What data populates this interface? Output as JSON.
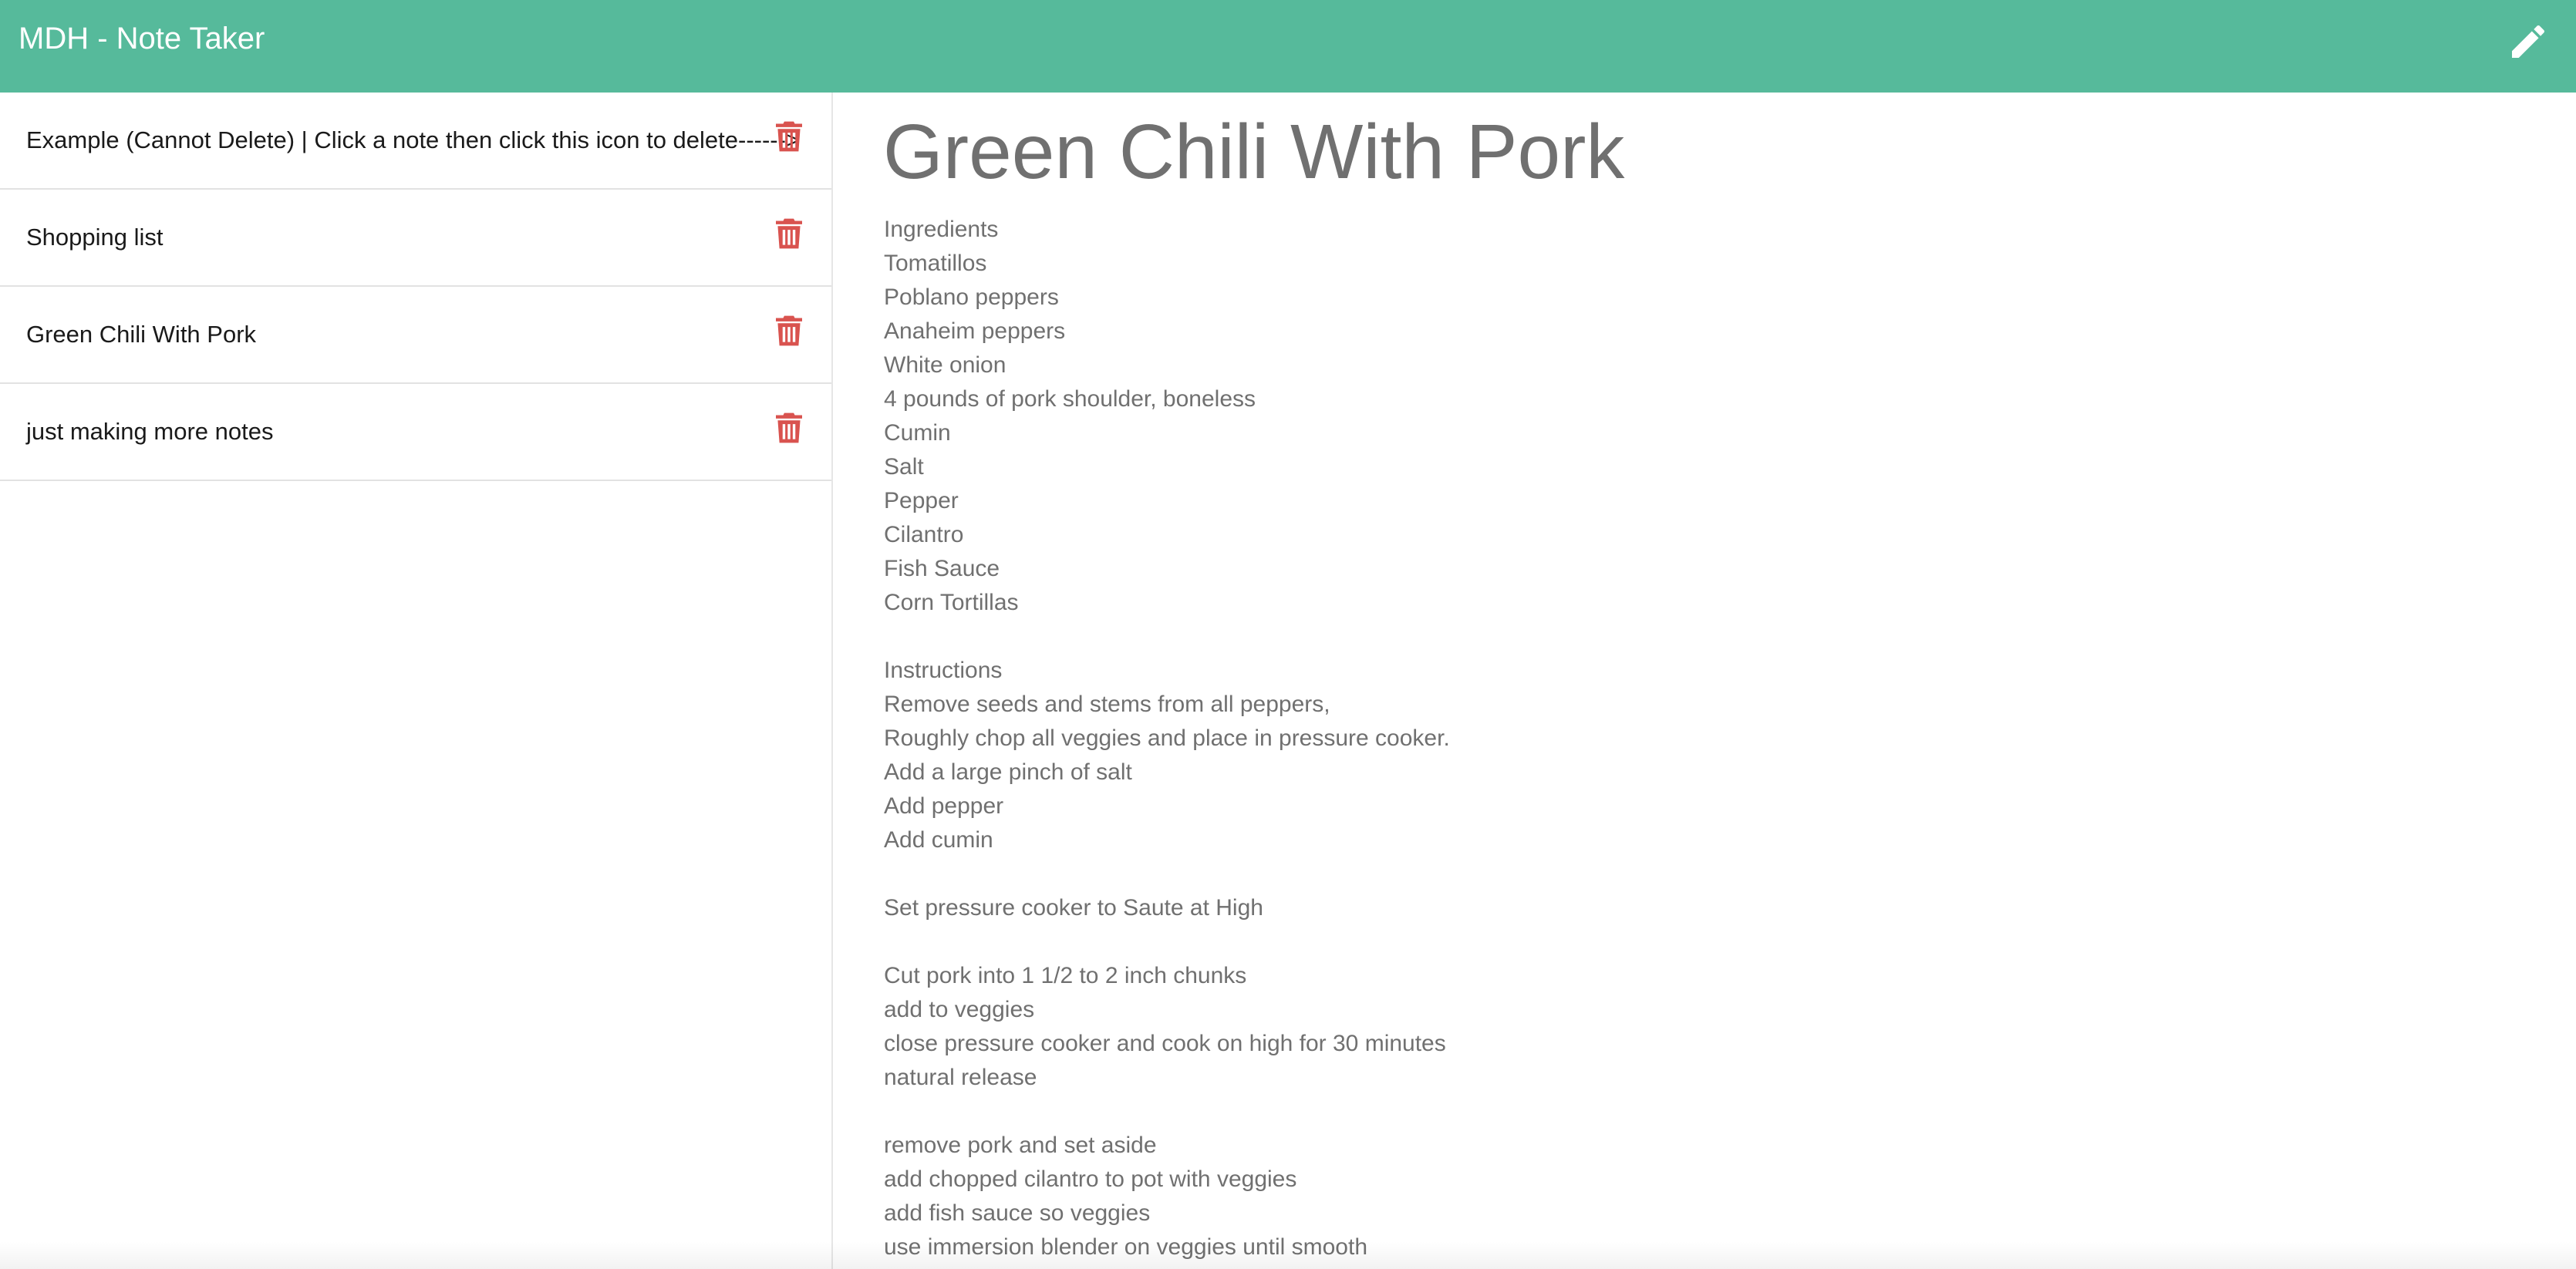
{
  "header": {
    "title": "MDH - Note Taker",
    "new_note_icon": "pencil-icon",
    "background_color": "#56ba9b"
  },
  "sidebar": {
    "delete_icon": "trash-icon",
    "delete_icon_color": "#d9534f",
    "notes": [
      {
        "title": "Example (Cannot Delete) | Click a note then click this icon to delete------>"
      },
      {
        "title": "Shopping list"
      },
      {
        "title": "Green Chili With Pork"
      },
      {
        "title": "just making more notes"
      }
    ]
  },
  "editor": {
    "note_title": "Green Chili With Pork",
    "note_text": "Ingredients\nTomatillos\nPoblano peppers\nAnaheim peppers\nWhite onion\n4 pounds of pork shoulder, boneless\nCumin\nSalt\nPepper\nCilantro\nFish Sauce\nCorn Tortillas\n\nInstructions\nRemove seeds and stems from all peppers,\nRoughly chop all veggies and place in pressure cooker.\nAdd a large pinch of salt\nAdd pepper\nAdd cumin\n\nSet pressure cooker to Saute at High\n\nCut pork into 1 1/2 to 2 inch chunks\nadd to veggies\nclose pressure cooker and cook on high for 30 minutes\nnatural release\n\nremove pork and set aside\nadd chopped cilantro to pot with veggies\nadd fish sauce so veggies\nuse immersion blender on veggies until smooth"
  }
}
